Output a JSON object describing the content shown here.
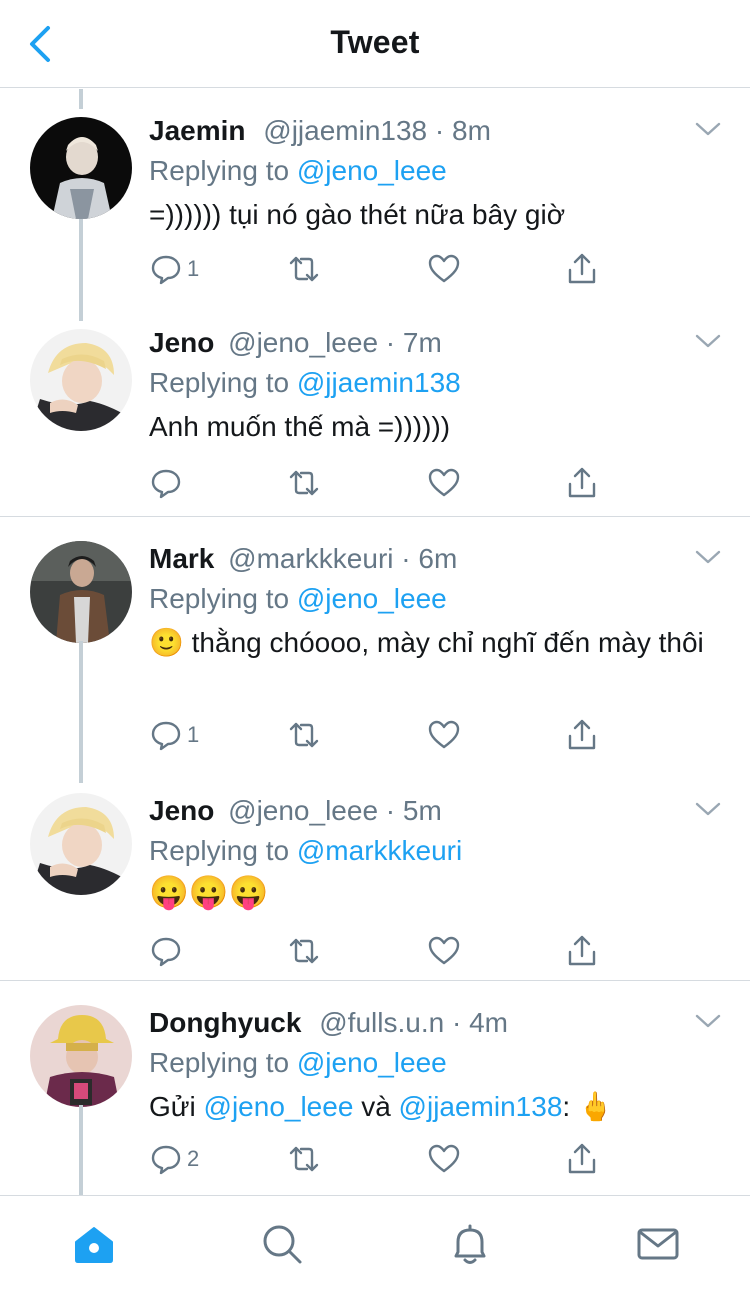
{
  "header": {
    "title": "Tweet",
    "back_icon": "chevron-left-icon"
  },
  "colors": {
    "accent": "#1da1f2",
    "secondary_text": "#657786",
    "divider": "#d6dbe0"
  },
  "tweets": [
    {
      "name": "Jaemin",
      "handle": "@jjaemin138",
      "time": "8m",
      "replying_prefix": "Replying to",
      "replying_to": "@jeno_leee",
      "text": "=)))))) tụi nó gào thét nữa bây giờ",
      "reply_count": "1"
    },
    {
      "name": "Jeno",
      "handle": "@jeno_leee",
      "time": "7m",
      "replying_prefix": "Replying to",
      "replying_to": "@jjaemin138",
      "text": "Anh muốn thế mà =))))))",
      "reply_count": ""
    },
    {
      "name": "Mark",
      "handle": "@markkkeuri",
      "time": "6m",
      "replying_prefix": "Replying to",
      "replying_to": "@jeno_leee",
      "text_emoji": "🙂",
      "text": "thằng chóooo, mày chỉ nghĩ đến mày thôi",
      "reply_count": "1"
    },
    {
      "name": "Jeno",
      "handle": "@jeno_leee",
      "time": "5m",
      "replying_prefix": "Replying to",
      "replying_to": "@markkkeuri",
      "text": "😛😛😛",
      "reply_count": ""
    },
    {
      "name": "Donghyuck",
      "handle": "@fulls.u.n",
      "time": "4m",
      "replying_prefix": "Replying to",
      "replying_to": "@jeno_leee",
      "text_prefix": "Gửi",
      "text_mention_1": "@jeno_leee",
      "text_middle": "và",
      "text_mention_2": "@jjaemin138",
      "text_suffix": ":",
      "text_emoji": "🖕",
      "reply_count": "2"
    }
  ],
  "separator_char": "·",
  "tabbar": {
    "tabs": [
      "home-icon",
      "search-icon",
      "notifications-icon",
      "messages-icon"
    ],
    "active": "home-icon"
  }
}
